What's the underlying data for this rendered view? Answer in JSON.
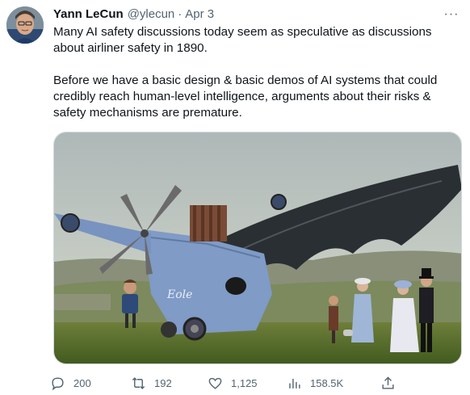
{
  "author": {
    "name": "Yann LeCun",
    "handle": "@ylecun",
    "separator": "·",
    "date": "Apr 3"
  },
  "more_label": "···",
  "tweet": {
    "paragraph1": "Many AI safety discussions today seem as speculative as discussions\nabout airliner safety in 1890.",
    "paragraph2": "Before we have a basic design & basic demos of AI systems that could\ncredibly reach human-level intelligence, arguments about their risks &\nsafety mechanisms are premature."
  },
  "media": {
    "plane_label": "Eole"
  },
  "actions": {
    "replies": "200",
    "retweets": "192",
    "likes": "1,125",
    "views": "158.5K"
  },
  "colors": {
    "text": "#0f1419",
    "secondary": "#536471",
    "border": "#cfd9de"
  }
}
